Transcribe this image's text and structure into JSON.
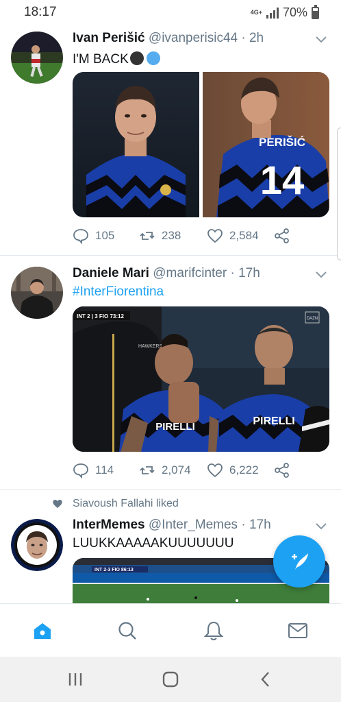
{
  "status_bar": {
    "time": "18:17",
    "network": "4G+",
    "battery": "70%"
  },
  "tweets": [
    {
      "name": "Ivan Perišić",
      "handle": "@ivanperisic44",
      "time": "· 2h",
      "text": "I'M BACK",
      "emoji_colors": [
        "#333333",
        "#55acee"
      ],
      "replies": "105",
      "retweets": "238",
      "likes": "2,584",
      "jersey_name": "PERIŠIĆ",
      "jersey_number": "14"
    },
    {
      "name": "Daniele Mari",
      "handle": "@marifcinter",
      "time": "· 17h",
      "text": "#InterFiorentina",
      "replies": "114",
      "retweets": "2,074",
      "likes": "6,222",
      "scorebug": "INT 2 | 3 FIO 73:12",
      "sponsor": "PIRELLI",
      "broadcaster": "DAZN"
    },
    {
      "liked_by": "Siavoush Fallahi liked",
      "name": "InterMemes",
      "handle": "@Inter_Memes",
      "time": "· 17h",
      "text": "LUUKKAAAAAKUUUUUUU",
      "scorebug": "INT 2-3 FIO 86:13"
    }
  ],
  "colors": {
    "accent": "#1da1f2",
    "secondary_text": "#657786",
    "inter_blue": "#1a3ea8"
  },
  "bottom_nav": [
    "home-icon",
    "search-icon",
    "bell-icon",
    "mail-icon"
  ]
}
